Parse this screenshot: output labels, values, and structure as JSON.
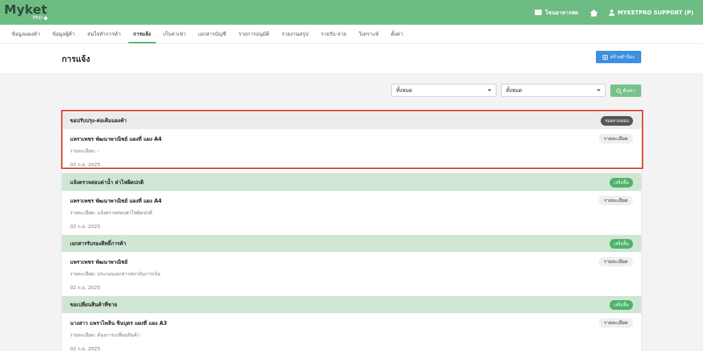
{
  "brand": {
    "name": "Myket",
    "sub": "PRO"
  },
  "topbar": {
    "store_label": "โซนอาหารสด",
    "user_label": "MYKETPRO SUPPORT (P)"
  },
  "nav": {
    "tabs": [
      {
        "label": "ข้อมูลแผงค้า"
      },
      {
        "label": "ข้อมูลผู้ค้า"
      },
      {
        "label": "สนใจทำการค้า"
      },
      {
        "label": "การแจ้ง"
      },
      {
        "label": "เก็บค่าเช่า"
      },
      {
        "label": "เอกสารบัญชี"
      },
      {
        "label": "รายการอนุมัติ"
      },
      {
        "label": "รายงานสรุป"
      },
      {
        "label": "รายรับ-จ่าย"
      },
      {
        "label": "วิเคราะห์"
      },
      {
        "label": "ตั้งค่า"
      }
    ],
    "active_index": 3
  },
  "page": {
    "title": "การแจ้ง",
    "create_label": "สร้างคำร้อง"
  },
  "filters": {
    "filter1": "ทั้งหมด",
    "filter2": "ทั้งหมด",
    "search_label": "ค้นหา"
  },
  "cards": [
    {
      "title": "ขอปรับปรุง-ต่อเติมแผงค้า",
      "status": "รอตรวจสอบ",
      "status_type": "pending",
      "row_title": "แพรวเพชร พัฒนาพาณิชย์ แผงที่ แผง A4",
      "detail": "รายละเอียด: -",
      "date": "02 ก.ย. 2025",
      "button": "รายละเอียด"
    },
    {
      "title": "แจ้งตรวจสอบค่าน้ำ ค่าไฟผิดปกติ",
      "status": "เสร็จสิ้น",
      "status_type": "done",
      "row_title": "แพรวเพชร พัฒนาพาณิชย์ แผงที่ แผง A4",
      "detail": "รายละเอียด: แจ้งตรวจสอบค่าไฟผิดปกติ",
      "date": "02 ก.ย. 2025",
      "button": "รายละเอียด"
    },
    {
      "title": "เอกสารรับรองสิทธิ์การค้า",
      "status": "เสร็จสิ้น",
      "status_type": "done",
      "row_title": "แพรวเพชร พัฒนาพาณิชย์",
      "detail": "รายละเอียด: ประกอบเอกสารสถาบันการเงิน",
      "date": "02 ก.ย. 2025",
      "button": "รายละเอียด"
    },
    {
      "title": "ขอเปลี่ยนสินค้าที่ขาย",
      "status": "เสร็จสิ้น",
      "status_type": "done",
      "row_title": "นางสาว แพรวไพลิน ชินบุตร แผงที่ แผง A3",
      "detail": "รายละเอียด: ต้องการเปลี่ยนสินค้า",
      "date": "02 ก.ย. 2025",
      "button": "รายละเอียด"
    }
  ],
  "colors": {
    "topbar": "#6dbc83",
    "accent_green": "#4caf6a",
    "create_button": "#3d8fe0",
    "highlight_border": "#e0412f",
    "badge_pending": "#555555",
    "badge_done": "#4db36a"
  }
}
